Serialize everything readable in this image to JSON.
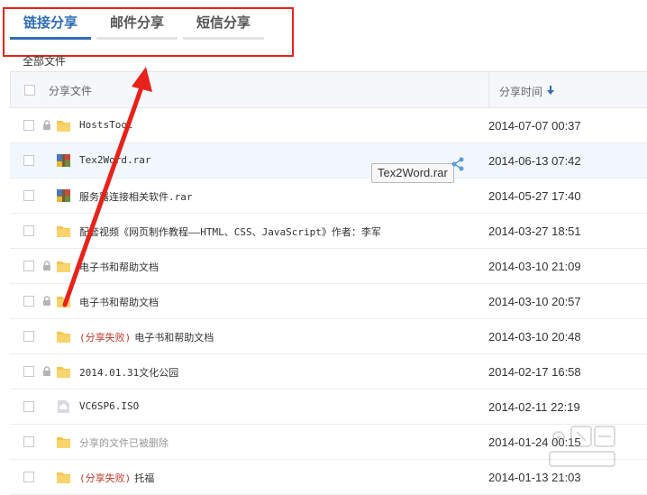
{
  "tabs": [
    {
      "label": "链接分享",
      "active": true
    },
    {
      "label": "邮件分享",
      "active": false
    },
    {
      "label": "短信分享",
      "active": false
    }
  ],
  "breadcrumb": "全部文件",
  "table": {
    "header_file": "分享文件",
    "header_time": "分享时间",
    "rows": [
      {
        "name": "HostsTool",
        "fail": "",
        "time": "2014-07-07 00:37",
        "icon": "folder-icon",
        "locked": true,
        "deleted": false
      },
      {
        "name": "Tex2Word.rar",
        "fail": "",
        "time": "2014-06-13 07:42",
        "icon": "rar-archive-icon",
        "locked": false,
        "deleted": false
      },
      {
        "name": "服务器连接相关软件.rar",
        "fail": "",
        "time": "2014-05-27 17:40",
        "icon": "rar-archive-icon",
        "locked": false,
        "deleted": false
      },
      {
        "name": "配套视频《网页制作教程——HTML、CSS、JavaScript》作者：李军",
        "fail": "",
        "time": "2014-03-27 18:51",
        "icon": "folder-icon",
        "locked": false,
        "deleted": false
      },
      {
        "name": "电子书和帮助文档",
        "fail": "",
        "time": "2014-03-10 21:09",
        "icon": "folder-icon",
        "locked": true,
        "deleted": false
      },
      {
        "name": "电子书和帮助文档",
        "fail": "",
        "time": "2014-03-10 20:57",
        "icon": "folder-icon",
        "locked": true,
        "deleted": false
      },
      {
        "name": "电子书和帮助文档",
        "fail": "(分享失败)",
        "time": "2014-03-10 20:48",
        "icon": "folder-icon",
        "locked": false,
        "deleted": false
      },
      {
        "name": "2014.01.31文化公园",
        "fail": "",
        "time": "2014-02-17 16:58",
        "icon": "folder-icon",
        "locked": true,
        "deleted": false
      },
      {
        "name": "VC6SP6.ISO",
        "fail": "",
        "time": "2014-02-11 22:19",
        "icon": "cloud-file-icon",
        "locked": false,
        "deleted": false
      },
      {
        "name": "分享的文件已被删除",
        "fail": "",
        "time": "2014-01-24 00:15",
        "icon": "folder-icon",
        "locked": false,
        "deleted": true
      },
      {
        "name": "托福",
        "fail": "(分享失败)",
        "time": "2014-01-13 21:03",
        "icon": "folder-icon",
        "locked": false,
        "deleted": false
      }
    ]
  },
  "tooltip": "Tex2Word.rar",
  "colors": {
    "accent": "#2f6db5",
    "annotation_red": "#e8221b",
    "folder_yellow": "#f6c54a",
    "fail_red": "#c0392b"
  }
}
